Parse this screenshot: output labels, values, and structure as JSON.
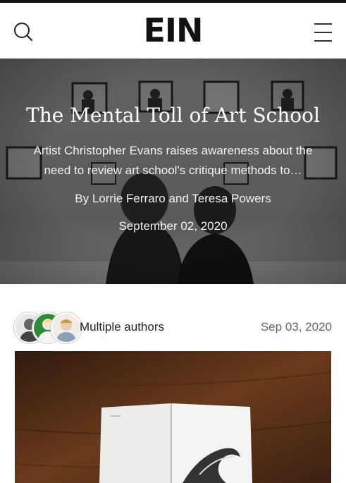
{
  "header": {
    "logo": "EIN",
    "search_icon": "search-icon",
    "menu_icon": "hamburger-menu-icon"
  },
  "hero": {
    "title": "The Mental Toll of Art School",
    "subtitle": "Artist Christopher Evans raises awareness about the need to review art school's critique methods to…",
    "byline": "By Lorrie Ferraro and Teresa Powers",
    "date": "September 02, 2020"
  },
  "post": {
    "authors_label": "Multiple authors",
    "date": "Sep 03, 2020"
  },
  "colors": {
    "text_dark": "#111111",
    "hero_overlay": "#5a5a5a",
    "avatar_green": "#2e8b3a",
    "wood": "#6b3a1c"
  }
}
